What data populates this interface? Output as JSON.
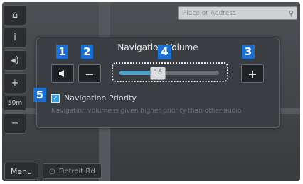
{
  "panel": {
    "title": "Navigation Volume",
    "mute_icon": "speaker-icon",
    "decrease_label": "−",
    "increase_label": "+",
    "volume": 16,
    "volume_fraction": 0.38,
    "priority_label": "Navigation Priority",
    "priority_checked": true,
    "priority_check": "✓",
    "priority_desc": "Navigation volume is given higher priority than other audio"
  },
  "callouts": [
    "1",
    "2",
    "3",
    "4",
    "5"
  ],
  "search": {
    "placeholder": "Place or Address",
    "icon": "search-icon"
  },
  "sidebar": [
    {
      "icon": "home-icon",
      "glyph": "⌂"
    },
    {
      "icon": "info-icon",
      "glyph": "i"
    },
    {
      "icon": "speaker-icon",
      "glyph": "◂)"
    },
    {
      "icon": "zoom-in-icon",
      "glyph": "+"
    },
    {
      "icon": "scale-icon",
      "glyph": "50m"
    },
    {
      "icon": "zoom-out-icon",
      "glyph": "−"
    }
  ],
  "bottom": {
    "menu_label": "Menu",
    "road_label": "Detroit Rd"
  },
  "colors": {
    "callout": "#1a6fd0",
    "slider_fill": "#4f9fc8"
  }
}
